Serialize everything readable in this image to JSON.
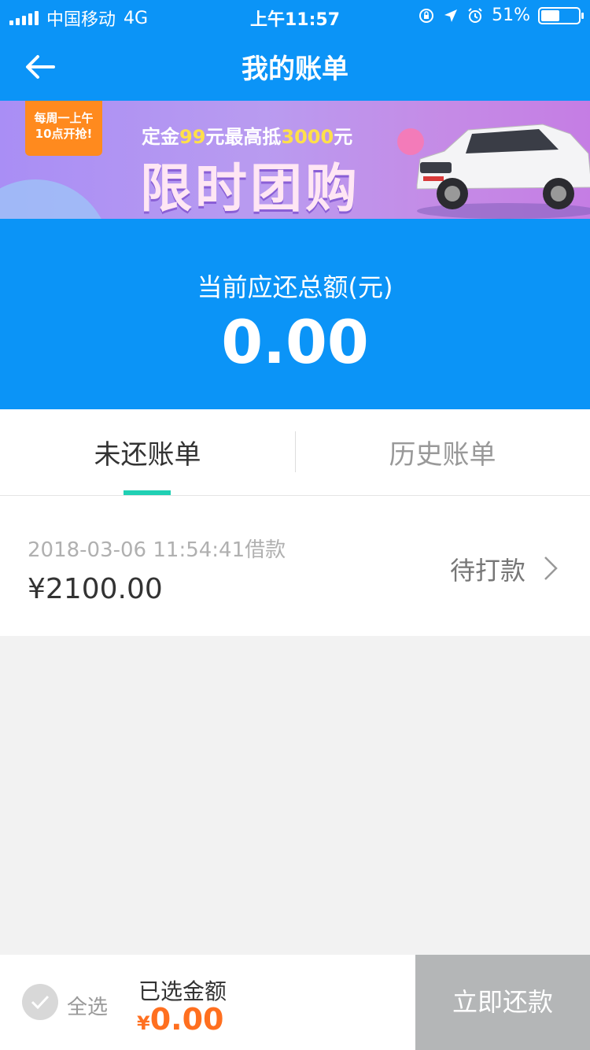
{
  "status_bar": {
    "carrier": "中国移动",
    "network": "4G",
    "time": "上午11:57",
    "battery": "51%",
    "battery_level": 0.51
  },
  "nav": {
    "title": "我的账单"
  },
  "banner": {
    "tag_line1": "每周一上午",
    "tag_line2": "10点开抢!",
    "promo_prefix": "定金",
    "promo_num1": "99",
    "promo_mid": "元最高抵",
    "promo_num2": "3000",
    "promo_suffix": "元",
    "headline": "限时团购"
  },
  "summary": {
    "label": "当前应还总额(元)",
    "amount": "0.00"
  },
  "tabs": [
    {
      "label": "未还账单",
      "active": true
    },
    {
      "label": "历史账单",
      "active": false
    }
  ],
  "bills": [
    {
      "date": "2018-03-06 11:54:41借款",
      "amount": "¥2100.00",
      "status": "待打款"
    }
  ],
  "footer": {
    "select_all": "全选",
    "selected_label": "已选金额",
    "currency": "¥",
    "selected_amount": "0.00",
    "pay_button": "立即还款"
  },
  "colors": {
    "primary": "#0b94f7",
    "accent_teal": "#20d0b4",
    "amount_orange": "#ff6f1f",
    "disabled_gray": "#b4b6b7"
  }
}
